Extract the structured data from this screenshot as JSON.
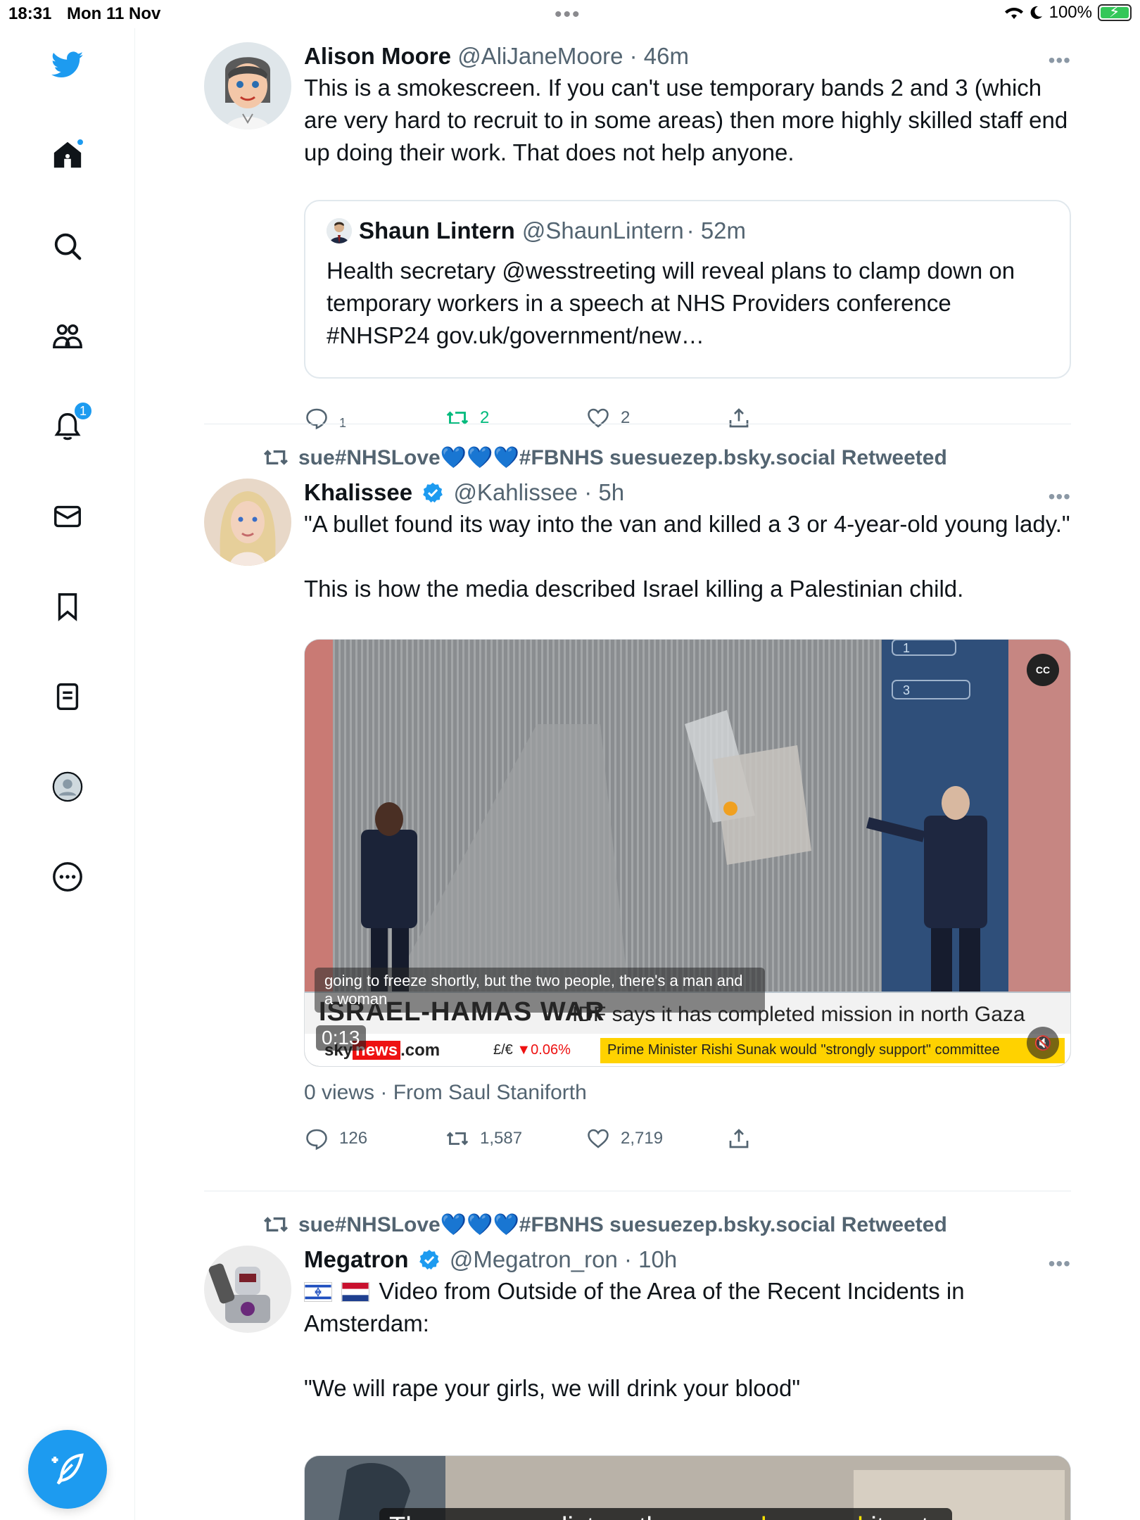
{
  "status_bar": {
    "time": "18:31",
    "date": "Mon 11 Nov",
    "battery": "100%"
  },
  "sidebar": {
    "items": [
      "twitter-logo",
      "home",
      "explore",
      "communities",
      "notifications",
      "messages",
      "bookmarks",
      "lists",
      "profile",
      "more"
    ],
    "notifications_badge": "1"
  },
  "tweets": [
    {
      "name": "Alison Moore",
      "handle": "@AliJaneMoore",
      "time": "· 46m",
      "text": "This is a smokescreen. If you can't use temporary bands 2 and 3 (which are very hard to recruit to in some areas) then more highly skilled staff end up doing their work. That does not help anyone.",
      "quote": {
        "name": "Shaun Lintern",
        "handle": "@ShaunLintern",
        "time": "· 52m",
        "text": "Health secretary @wesstreeting will reveal plans to clamp down on temporary workers in a speech at NHS Providers conference #NHSP24  gov.uk/government/new…"
      },
      "replies": "1",
      "retweets": "2",
      "likes": "2"
    },
    {
      "retweeted_by": "sue#NHSLove💙💙💙#FBNHS suesuezep.bsky.social Retweeted",
      "name": "Khalissee",
      "handle": "@Kahlissee",
      "time": "· 5h",
      "text_1": "\"A bullet found its way into the van and killed a 3 or 4-year-old young lady.\"",
      "text_2": "This is how the media described Israel killing a Palestinian child.",
      "video": {
        "caption": "going to freeze shortly, but the two people, there's a man and a woman",
        "banner_title": "ISRAEL-HAMAS WAR",
        "banner_headline": "IDF says it has completed mission in north Gaza",
        "channel_sky": "sky",
        "channel_news": "news",
        "channel_com": ".com",
        "fx": "£/€",
        "fx_change": "▼0.06%",
        "market": "Prime Minister Rishi Sunak would \"strongly support\" committee",
        "duration": "0:13",
        "cc": "CC",
        "screen_num_1": "1",
        "screen_num_3": "3"
      },
      "views": "0 views · From Saul Staniforth",
      "replies": "126",
      "retweets": "1,587",
      "likes": "2,719"
    },
    {
      "retweeted_by": "sue#NHSLove💙💙💙#FBNHS suesuezep.bsky.social Retweeted",
      "name": "Megatron",
      "handle": "@Megatron_ron",
      "time": "· 10h",
      "text_1": "Video from Outside of the Area of the Recent Incidents in Amsterdam:",
      "text_2": "\"We will rape your girls, we will drink your blood\"",
      "video_caption_1": "The more you listen, the ",
      "video_caption_2": "more depraved",
      "video_caption_3": " it gets"
    }
  ],
  "colors": {
    "accent": "#1d9bf0",
    "retweet_green": "#00ba7c",
    "secondary_text": "#536471"
  }
}
